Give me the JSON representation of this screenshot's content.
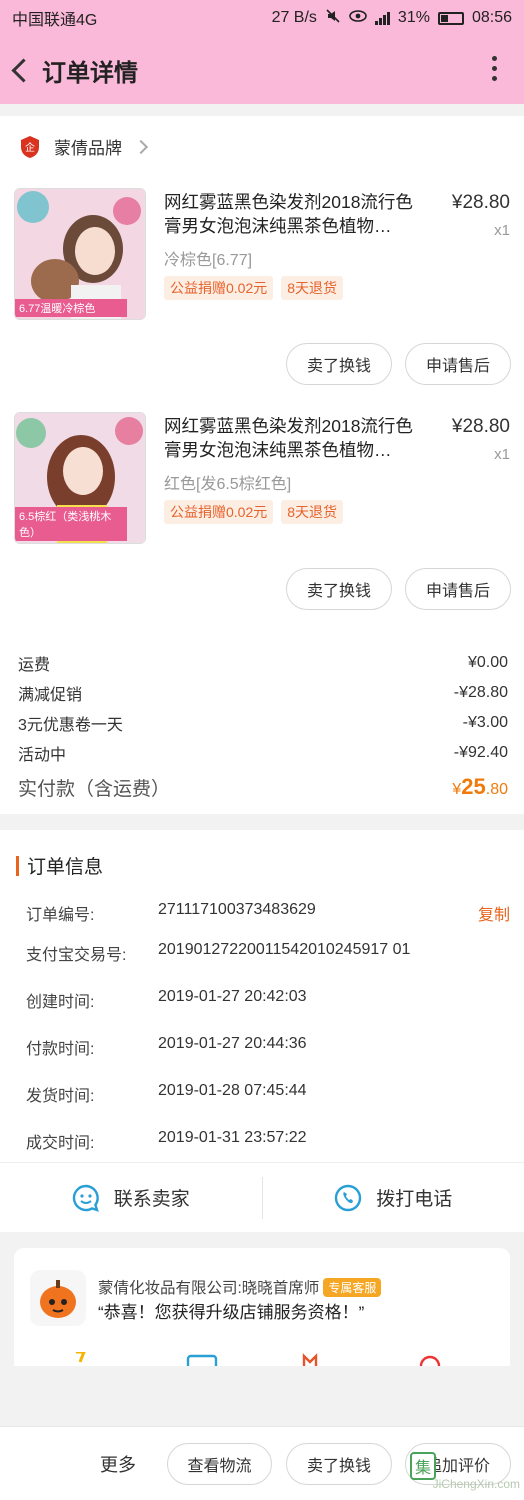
{
  "status_bar": {
    "carrier": "中国联通4G",
    "speed": "27 B/s",
    "network": "4G",
    "battery": "31%",
    "time": "08:56"
  },
  "header": {
    "title": "订单详情"
  },
  "shop": {
    "name": "蒙倩品牌",
    "icon_text": "企"
  },
  "items": [
    {
      "name": "网红雾蓝黑色染发剂2018流行色膏男女泡泡沫纯黑茶色植物…",
      "price": "¥28.80",
      "qty": "x1",
      "variant": "冷棕色[6.77]",
      "thumb_caption": "6.77温暖冷棕色",
      "tags": [
        "公益捐赠0.02元",
        "8天退货"
      ],
      "buttons": [
        "卖了换钱",
        "申请售后"
      ]
    },
    {
      "name": "网红雾蓝黑色染发剂2018流行色膏男女泡泡沫纯黑茶色植物…",
      "price": "¥28.80",
      "qty": "x1",
      "variant": "红色[发6.5棕红色]",
      "thumb_caption": "6.5棕红（类浅桃木色）",
      "tags": [
        "公益捐赠0.02元",
        "8天退货"
      ],
      "buttons": [
        "卖了换钱",
        "申请售后"
      ]
    }
  ],
  "costs": [
    {
      "label": "运费",
      "value": "¥0.00"
    },
    {
      "label": "满减促销",
      "value": "-¥28.80"
    },
    {
      "label": "3元优惠卷一天",
      "value": "-¥3.00"
    },
    {
      "label": "活动中",
      "value": "-¥92.40"
    }
  ],
  "total": {
    "label": "实付款（含运费）",
    "currency": "¥",
    "integer": "25",
    "decimal": ".80"
  },
  "order_info": {
    "title": "订单信息",
    "copy_label": "复制",
    "rows": [
      {
        "label": "订单编号:",
        "value": "271117100373483629"
      },
      {
        "label": "支付宝交易号:",
        "value": "20190127220011542010245917 01"
      },
      {
        "label": "创建时间:",
        "value": "2019-01-27 20:42:03"
      },
      {
        "label": "付款时间:",
        "value": "2019-01-27 20:44:36"
      },
      {
        "label": "发货时间:",
        "value": "2019-01-28 07:45:44"
      },
      {
        "label": "成交时间:",
        "value": "2019-01-31 23:57:22"
      }
    ]
  },
  "contact": {
    "seller": "联系卖家",
    "phone": "拨打电话"
  },
  "service": {
    "name": "蒙倩化妆品有限公司:晓晓首席师",
    "badge": "专属客服",
    "message": "“恭喜！您获得升级店铺服务资格！”"
  },
  "bottom_bar": {
    "more": "更多",
    "buttons": [
      "查看物流",
      "卖了换钱",
      "追加评价"
    ],
    "watermark": "JiChengXin.com",
    "watermark_box": "集"
  },
  "colors": {
    "header_bg": "#fbb9d9",
    "accent_orange": "#e9641d",
    "price_orange": "#f07b0c",
    "contact_blue": "#2a9fd6"
  }
}
